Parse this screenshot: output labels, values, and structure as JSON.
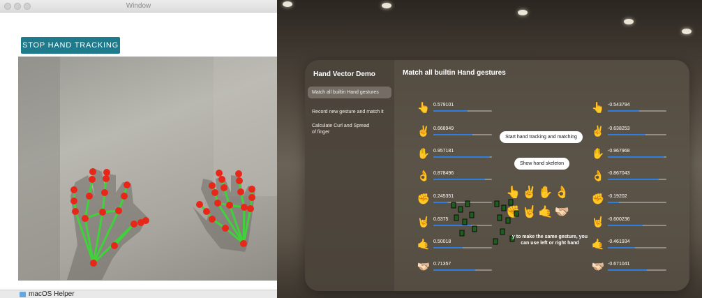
{
  "left_window": {
    "title": "Window",
    "stop_button": "STOP HAND TRACKING",
    "dock_label": "macOS Helper"
  },
  "app": {
    "title": "Hand Vector Demo",
    "main_title": "Match all builtin Hand gestures",
    "nav": [
      "Match all builtin Hand gestures",
      "Record new gesture and match it",
      "Calculate Curl and Spread of finger"
    ],
    "start_button": "Start hand tracking and matching",
    "skeleton_button": "Show hand skeleton",
    "hint_text": "y to make the same gesture, you can use left or right hand",
    "gesture_emojis": [
      "👆",
      "✌️",
      "✋",
      "👌",
      "✊",
      "🤘",
      "🤙",
      "🫱🏻‍🫲🏼"
    ],
    "left_scores": [
      {
        "emoji": "👆",
        "value": "0.579101",
        "fraction": 0.58
      },
      {
        "emoji": "✌️",
        "value": "0.668949",
        "fraction": 0.67
      },
      {
        "emoji": "✋",
        "value": "0.957181",
        "fraction": 0.96
      },
      {
        "emoji": "👌",
        "value": "0.878496",
        "fraction": 0.88
      },
      {
        "emoji": "✊",
        "value": "0.245351",
        "fraction": 0.25
      },
      {
        "emoji": "🤘",
        "value": "0.6375",
        "fraction": 0.64
      },
      {
        "emoji": "🤙",
        "value": "0.50018",
        "fraction": 0.5
      },
      {
        "emoji": "🫱🏻‍🫲🏼",
        "value": "0.71357",
        "fraction": 0.71
      }
    ],
    "right_scores": [
      {
        "emoji": "👆",
        "value": "-0.543794",
        "fraction": 0.54
      },
      {
        "emoji": "✌️",
        "value": "-0.638253",
        "fraction": 0.64
      },
      {
        "emoji": "✋",
        "value": "-0.967968",
        "fraction": 0.97
      },
      {
        "emoji": "👌",
        "value": "-0.867043",
        "fraction": 0.87
      },
      {
        "emoji": "✊",
        "value": "-0.19202",
        "fraction": 0.19
      },
      {
        "emoji": "🤘",
        "value": "-0.600236",
        "fraction": 0.6
      },
      {
        "emoji": "🤙",
        "value": "-0.461934",
        "fraction": 0.46
      },
      {
        "emoji": "🫱🏻‍🫲🏼",
        "value": "-0.671041",
        "fraction": 0.67
      }
    ]
  },
  "colors": {
    "stop_button": "#1f7a8c",
    "progress_fill": "#2f7fe0",
    "landmark": "#e8271a",
    "skeleton_line": "#3fd23a"
  }
}
